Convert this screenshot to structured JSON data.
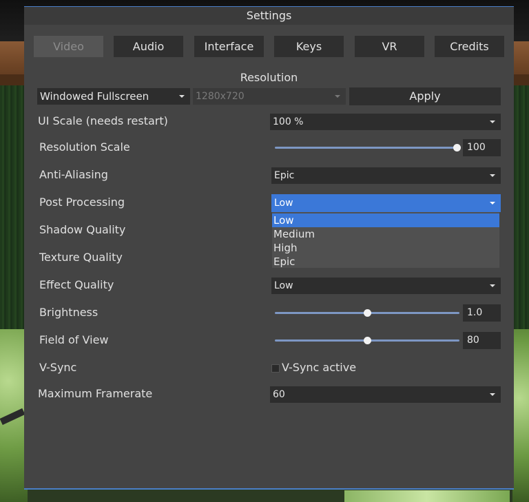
{
  "window": {
    "title": "Settings"
  },
  "tabs": [
    {
      "label": "Video",
      "active": true
    },
    {
      "label": "Audio",
      "active": false
    },
    {
      "label": "Interface",
      "active": false
    },
    {
      "label": "Keys",
      "active": false
    },
    {
      "label": "VR",
      "active": false
    },
    {
      "label": "Credits",
      "active": false
    }
  ],
  "resolution": {
    "title": "Resolution",
    "mode": "Windowed Fullscreen",
    "size": "1280x720",
    "apply_label": "Apply"
  },
  "settings": {
    "ui_scale": {
      "label": "UI Scale (needs restart)",
      "value": "100 %"
    },
    "resolution_scale": {
      "label": "Resolution Scale",
      "value": "100",
      "fraction": 1.0
    },
    "anti_aliasing": {
      "label": "Anti-Aliasing",
      "value": "Epic"
    },
    "post_processing": {
      "label": "Post Processing",
      "value": "Low"
    },
    "shadow_quality": {
      "label": "Shadow Quality"
    },
    "texture_quality": {
      "label": "Texture Quality"
    },
    "effect_quality": {
      "label": "Effect Quality",
      "value": "Low"
    },
    "brightness": {
      "label": "Brightness",
      "value": "1.0",
      "fraction": 0.5
    },
    "field_of_view": {
      "label": "Field of View",
      "value": "80",
      "fraction": 0.5
    },
    "vsync": {
      "label": "V-Sync",
      "checkbox_label": "V-Sync active",
      "checked": false
    },
    "max_framerate": {
      "label": "Maximum Framerate",
      "value": "60"
    }
  },
  "popup": {
    "options": [
      "Low",
      "Medium",
      "High",
      "Epic"
    ],
    "selected": "Low"
  },
  "colors": {
    "accent": "#3b78d8",
    "panel": "#444444",
    "field": "#2d2d2d"
  }
}
